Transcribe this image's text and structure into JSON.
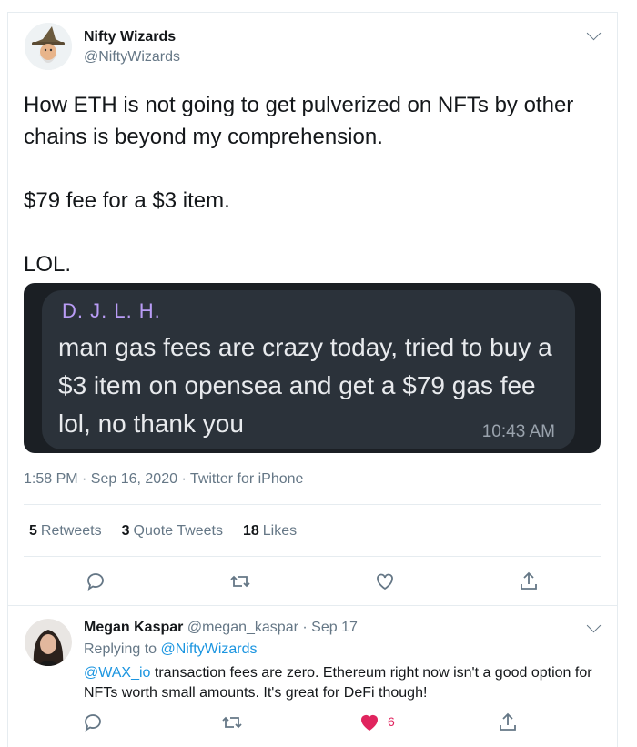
{
  "tweet": {
    "author_name": "Nifty Wizards",
    "author_handle": "@NiftyWizards",
    "text": "How ETH is not going to get pulverized on NFTs by other chains is beyond my comprehension.\n\n$79 fee for a $3 item.\n\nLOL.",
    "media": {
      "sender": "D. J. L. H.",
      "message": "man gas fees are crazy today, tried to buy a $3 item on opensea and get a $79 gas fee lol, no thank you",
      "time": "10:43 AM"
    },
    "timestamp": "1:58 PM · Sep 16, 2020 · Twitter for iPhone",
    "stats": {
      "retweets_count": "5",
      "retweets_label": "Retweets",
      "quotes_count": "3",
      "quotes_label": "Quote Tweets",
      "likes_count": "18",
      "likes_label": "Likes"
    },
    "actions": [
      "reply-icon",
      "retweet-icon",
      "like-icon",
      "share-icon"
    ]
  },
  "reply": {
    "author_name": "Megan Kaspar",
    "author_handle": "@megan_kaspar",
    "date": "· Sep 17",
    "replying_prefix": "Replying to",
    "replying_to": "@NiftyWizards",
    "mention": "@WAX_io",
    "text": " transaction fees are zero.  Ethereum right now isn't a good option for NFTs worth small amounts.  It's great for DeFi though!",
    "like_count": "6",
    "like_color": "#e0245e"
  },
  "colors": {
    "accent": "#1b95e0",
    "muted": "#657786",
    "border": "#e6ecf0"
  }
}
